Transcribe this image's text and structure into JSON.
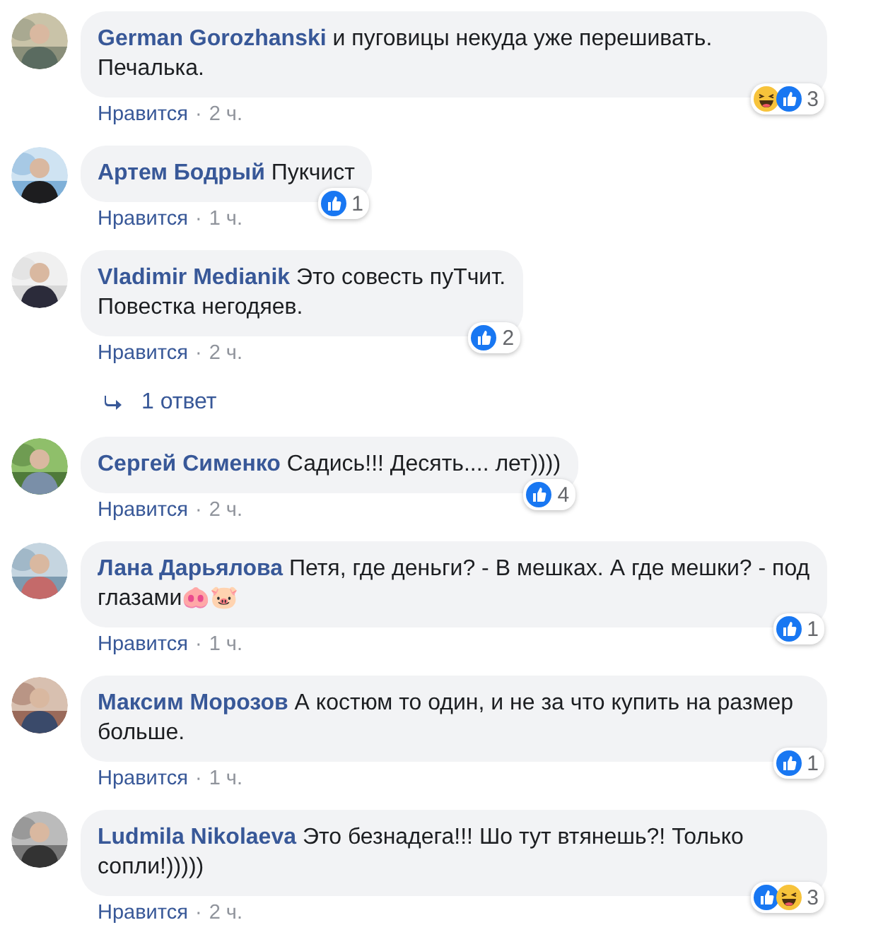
{
  "comments": [
    {
      "author": "German Gorozhanski",
      "text": "и пуговицы некуда уже перешивать. Печалька.",
      "reactions": [
        {
          "kind": "haha"
        },
        {
          "kind": "like"
        }
      ],
      "reaction_count": "3",
      "like_label": "Нравится",
      "separator": "·",
      "time": "2 ч."
    },
    {
      "author": "Артем Бодрый",
      "text": "Пукчист",
      "reactions": [
        {
          "kind": "like"
        }
      ],
      "reaction_count": "1",
      "like_label": "Нравится",
      "separator": "·",
      "time": "1 ч."
    },
    {
      "author": "Vladimir Medianik",
      "text": "Это совесть пуТчит.\nПовестка негодяев.",
      "reactions": [
        {
          "kind": "like"
        }
      ],
      "reaction_count": "2",
      "like_label": "Нравится",
      "separator": "·",
      "time": "2 ч.",
      "replies": "1 ответ"
    },
    {
      "author": "Сергей Сименко",
      "text": "Садись!!! Десять.... лет))))",
      "reactions": [
        {
          "kind": "like"
        }
      ],
      "reaction_count": "4",
      "like_label": "Нравится",
      "separator": "·",
      "time": "2 ч."
    },
    {
      "author": "Лана Дарьялова",
      "text": "Петя, где деньги? - В мешках. А где мешки? - под глазами🐽🐷",
      "reactions": [
        {
          "kind": "like"
        }
      ],
      "reaction_count": "1",
      "like_label": "Нравится",
      "separator": "·",
      "time": "1 ч."
    },
    {
      "author": "Максим Морозов",
      "text": "А костюм то один, и не за что купить на размер больше.",
      "reactions": [
        {
          "kind": "like"
        }
      ],
      "reaction_count": "1",
      "like_label": "Нравится",
      "separator": "·",
      "time": "1 ч."
    },
    {
      "author": "Ludmila Nikolaeva",
      "text": "Это безнадега!!! Шо тут втянешь?! Только сопли!)))))",
      "reactions": [
        {
          "kind": "like"
        },
        {
          "kind": "haha"
        }
      ],
      "reaction_count": "3",
      "like_label": "Нравится",
      "separator": "·",
      "time": "2 ч."
    }
  ]
}
